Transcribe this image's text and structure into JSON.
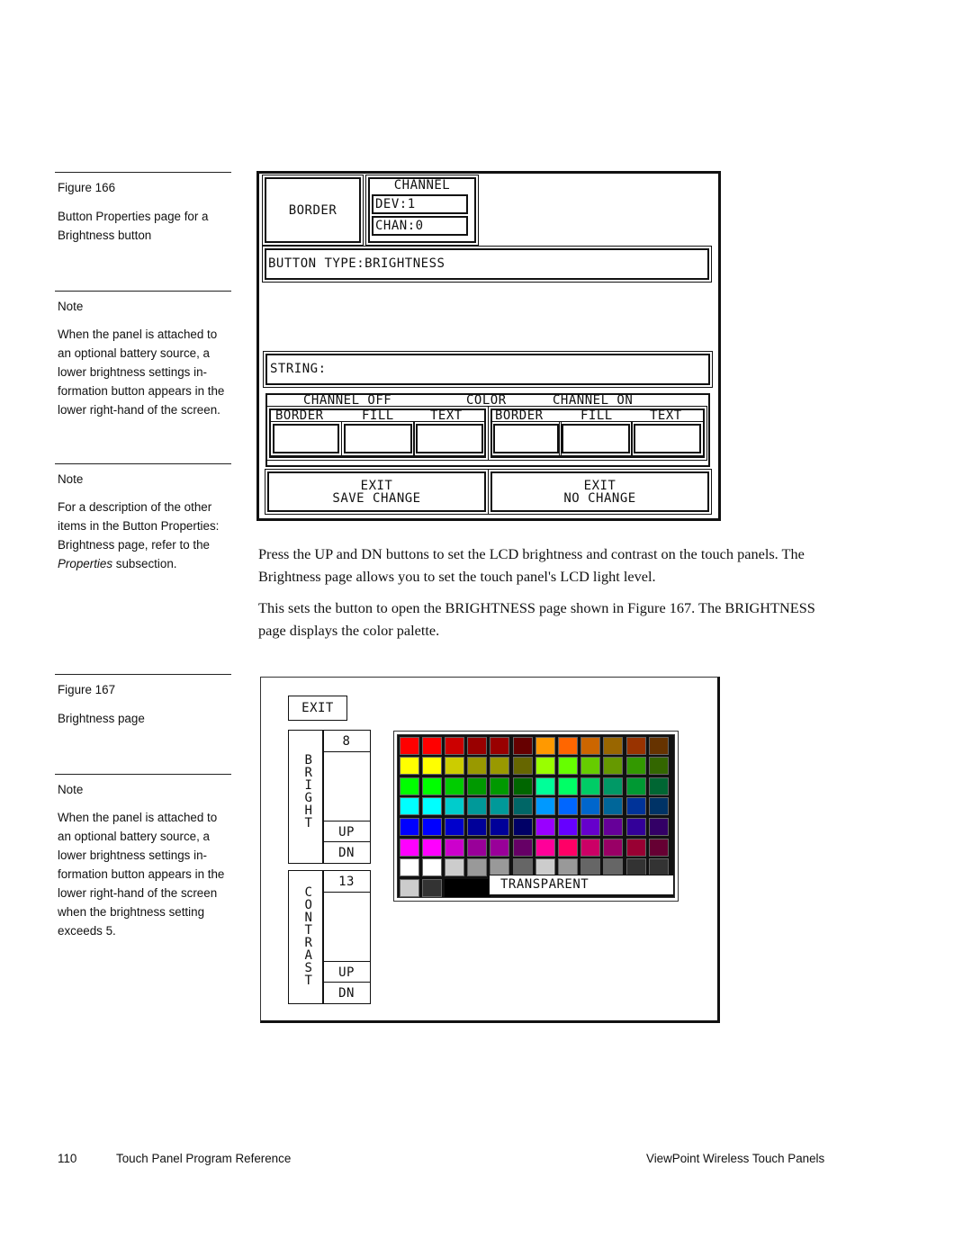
{
  "sidebar": {
    "figure166": {
      "label": "Figure 166",
      "caption": "Button Properties page for a Brightness button"
    },
    "note1": {
      "label": "Note",
      "text": "When the panel is attached to an optional battery source, a lower brightness settings in-formation button appears in the lower right-hand of the screen."
    },
    "note2": {
      "label": "Note",
      "text_before": "For a description of the other items in the Button Properties: Brightness page, refer to the ",
      "text_italic": "Properties",
      "text_after": " subsection."
    },
    "figure167": {
      "label": "Figure 167",
      "caption": "Brightness page"
    },
    "note3": {
      "label": "Note",
      "text": "When the panel is attached to an optional battery source, a lower brightness settings in-formation button appears in the lower right-hand of the screen when the brightness setting exceeds 5."
    }
  },
  "figure166": {
    "border_label": "BORDER",
    "channel": {
      "title": "CHANNEL",
      "dev": "DEV:1",
      "chan": "CHAN:0"
    },
    "button_type": "BUTTON TYPE:BRIGHTNESS",
    "string": "STRING:",
    "color_section": {
      "channel_off": "CHANNEL OFF",
      "color": "COLOR",
      "channel_on": "CHANNEL ON",
      "off_columns": [
        "BORDER",
        "FILL",
        "TEXT"
      ],
      "on_columns": [
        "BORDER",
        "FILL",
        "TEXT"
      ]
    },
    "exit_save": {
      "line1": "EXIT",
      "line2": "SAVE CHANGE"
    },
    "exit_no_change": {
      "line1": "EXIT",
      "line2": "NO CHANGE"
    }
  },
  "body": {
    "para1": "Press the UP and DN buttons to set the LCD brightness and contrast on the touch panels. The Brightness page allows you to set the touch panel's LCD light level.",
    "para2": "This sets the button to open the BRIGHTNESS page shown in Figure 167. The BRIGHTNESS page displays the color palette."
  },
  "figure167": {
    "exit": "EXIT",
    "bright": {
      "label": "BRIGHT",
      "value": "8",
      "up": "UP",
      "dn": "DN"
    },
    "contrast": {
      "label": "CONTRAST",
      "value": "13",
      "up": "UP",
      "dn": "DN"
    },
    "transparent": "TRANSPARENT",
    "palette": [
      [
        "#ff0000",
        "#ff0000",
        "#cc0000",
        "#990000",
        "#990000",
        "#660000",
        "#ff9900",
        "#ff6600",
        "#cc6600",
        "#996600",
        "#993300",
        "#663300"
      ],
      [
        "#ffff00",
        "#ffff00",
        "#cccc00",
        "#999900",
        "#999900",
        "#666600",
        "#99ff00",
        "#66ff00",
        "#66cc00",
        "#669900",
        "#339900",
        "#336600"
      ],
      [
        "#00ff00",
        "#00ff00",
        "#00cc00",
        "#009900",
        "#009900",
        "#006600",
        "#00ff99",
        "#00ff66",
        "#00cc66",
        "#009966",
        "#009933",
        "#006633"
      ],
      [
        "#00ffff",
        "#00ffff",
        "#00cccc",
        "#009999",
        "#009999",
        "#006666",
        "#0099ff",
        "#0066ff",
        "#0066cc",
        "#006699",
        "#003399",
        "#003366"
      ],
      [
        "#0000ff",
        "#0000ff",
        "#0000cc",
        "#000099",
        "#000099",
        "#000066",
        "#9900ff",
        "#6600ff",
        "#6600cc",
        "#660099",
        "#330099",
        "#330066"
      ],
      [
        "#ff00ff",
        "#ff00ff",
        "#cc00cc",
        "#990099",
        "#990099",
        "#660066",
        "#ff0099",
        "#ff0066",
        "#cc0066",
        "#990066",
        "#990033",
        "#660033"
      ],
      [
        "#ffffff",
        "#ffffff",
        "#cccccc",
        "#999999",
        "#999999",
        "#666666",
        "#cccccc",
        "#999999",
        "#666666",
        "#666666",
        "#333333",
        "#333333"
      ]
    ],
    "last_row": [
      "#cccccc",
      "#333333",
      "#000000",
      "#000000"
    ]
  },
  "footer": {
    "page_number": "110",
    "left_title": "Touch Panel Program Reference",
    "right_title": "ViewPoint Wireless Touch Panels"
  }
}
